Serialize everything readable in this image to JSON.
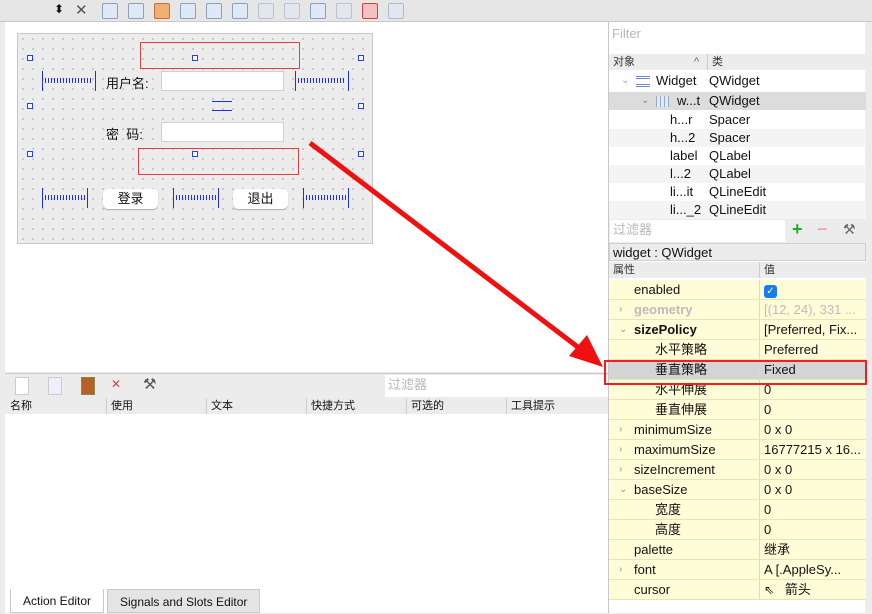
{
  "toolbar": {
    "icons": [
      "sort-arrows-icon",
      "close-icon",
      "edit-widgets-icon",
      "edit-signals-slots-icon",
      "edit-buddies-icon",
      "edit-tab-order-icon",
      "layout-horizontal-icon",
      "layout-vertical-icon",
      "splitter-horizontal-icon",
      "splitter-vertical-icon",
      "layout-form-icon",
      "layout-grid-icon",
      "break-layout-icon",
      "adjust-size-icon"
    ]
  },
  "form": {
    "username_label": "用户名:",
    "password_label": "密  码:",
    "login_button": "登录",
    "exit_button": "退出"
  },
  "object_inspector": {
    "filter_placeholder": "Filter",
    "col_object": "对象",
    "col_class": "类",
    "rows": [
      {
        "name": "Widget",
        "cls": "QWidget"
      },
      {
        "name": "w...t",
        "cls": "QWidget"
      },
      {
        "name": "h...r",
        "cls": "Spacer"
      },
      {
        "name": "h...2",
        "cls": "Spacer"
      },
      {
        "name": "label",
        "cls": "QLabel"
      },
      {
        "name": "l...2",
        "cls": "QLabel"
      },
      {
        "name": "li...it",
        "cls": "QLineEdit"
      },
      {
        "name": "li..._2",
        "cls": "QLineEdit"
      }
    ]
  },
  "property_editor": {
    "filter_placeholder": "过滤器",
    "object_title": "widget : QWidget",
    "col_property": "属性",
    "col_value": "值",
    "rows": [
      {
        "name": "enabled",
        "value": ""
      },
      {
        "name": "geometry",
        "value": "[(12, 24), 331 ..."
      },
      {
        "name": "sizePolicy",
        "value": "[Preferred, Fix..."
      },
      {
        "name": "水平策略",
        "value": "Preferred"
      },
      {
        "name": "垂直策略",
        "value": "Fixed"
      },
      {
        "name": "水平伸展",
        "value": "0"
      },
      {
        "name": "垂直伸展",
        "value": "0"
      },
      {
        "name": "minimumSize",
        "value": "0 x 0"
      },
      {
        "name": "maximumSize",
        "value": "16777215 x 16..."
      },
      {
        "name": "sizeIncrement",
        "value": "0 x 0"
      },
      {
        "name": "baseSize",
        "value": "0 x 0"
      },
      {
        "name": "宽度",
        "value": "0"
      },
      {
        "name": "高度",
        "value": "0"
      },
      {
        "name": "palette",
        "value": "继承"
      },
      {
        "name": "font",
        "value": "A  [.AppleSy..."
      },
      {
        "name": "cursor",
        "value": "箭头"
      }
    ],
    "enabled_checked": true
  },
  "action_editor": {
    "filter_placeholder": "过滤器",
    "columns": [
      "名称",
      "使用",
      "文本",
      "快捷方式",
      "可选的",
      "工具提示"
    ]
  },
  "tabs": [
    "Action Editor",
    "Signals and Slots Editor"
  ],
  "colors": {
    "highlight": "#e53935",
    "property_bg": "#fffdd8",
    "selection_handle": "#2040ff"
  }
}
